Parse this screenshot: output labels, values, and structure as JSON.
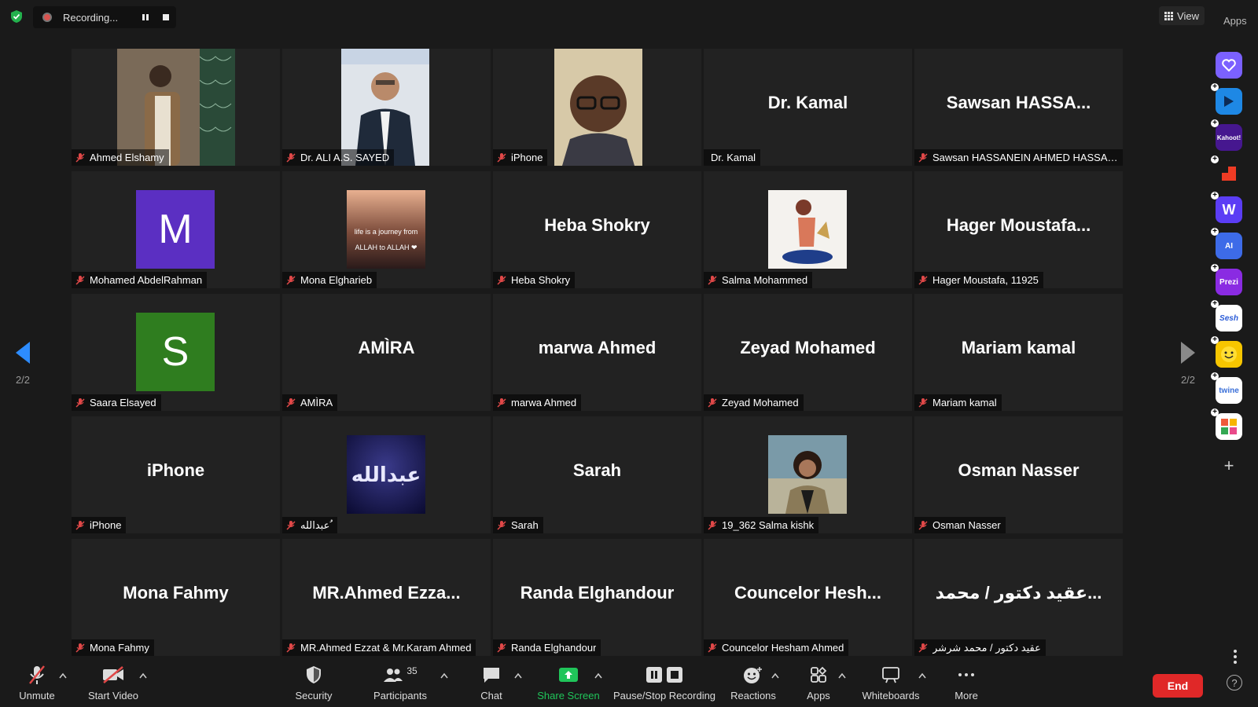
{
  "recording": {
    "label": "Recording..."
  },
  "view": {
    "label": "View"
  },
  "apps_label": "Apps",
  "pagination": {
    "left": "2/2",
    "right": "2/2"
  },
  "participants": [
    {
      "name": "Ahmed Elshamy",
      "display": "",
      "kind": "photo"
    },
    {
      "name": "Dr. ALI A.S. SAYED",
      "display": "",
      "kind": "photo"
    },
    {
      "name": "iPhone",
      "display": "",
      "kind": "photo"
    },
    {
      "name": "Dr. Kamal",
      "display": "Dr. Kamal",
      "kind": "text"
    },
    {
      "name": "Sawsan HASSANEIN AHMED HASSANEI...",
      "display": "Sawsan  HASSA...",
      "kind": "text"
    },
    {
      "name": "Mohamed AbdelRahman",
      "display": "",
      "kind": "avatar",
      "letter": "M",
      "color": "#5b2fc2"
    },
    {
      "name": "Mona Elgharieb",
      "display": "",
      "kind": "image",
      "image_text": [
        "life is a journey from",
        "ALLAH to ALLAH ❤"
      ]
    },
    {
      "name": "Heba Shokry",
      "display": "Heba Shokry",
      "kind": "text"
    },
    {
      "name": "Salma Mohammed",
      "display": "",
      "kind": "image"
    },
    {
      "name": "Hager Moustafa, 11925",
      "display": "Hager  Moustafa...",
      "kind": "text"
    },
    {
      "name": "Saara Elsayed",
      "display": "",
      "kind": "avatar",
      "letter": "S",
      "color": "#2f7d1f"
    },
    {
      "name": "AMÌRA",
      "display": "AMÌRA",
      "kind": "text"
    },
    {
      "name": "marwa Ahmed",
      "display": "marwa Ahmed",
      "kind": "text"
    },
    {
      "name": "Zeyad Mohamed",
      "display": "Zeyad Mohamed",
      "kind": "text"
    },
    {
      "name": "Mariam kamal",
      "display": "Mariam kamal",
      "kind": "text"
    },
    {
      "name": "iPhone",
      "display": "iPhone",
      "kind": "text"
    },
    {
      "name": "عبدالله ُ",
      "display": "",
      "kind": "image",
      "image_text": [
        "عبدالله"
      ]
    },
    {
      "name": "Sarah",
      "display": "Sarah",
      "kind": "text"
    },
    {
      "name": "19_362 Salma kishk",
      "display": "",
      "kind": "photo"
    },
    {
      "name": "Osman Nasser",
      "display": "Osman Nasser",
      "kind": "text"
    },
    {
      "name": "Mona Fahmy",
      "display": "Mona Fahmy",
      "kind": "text"
    },
    {
      "name": "MR.Ahmed Ezzat & Mr.Karam Ahmed",
      "display": "MR.Ahmed  Ezza...",
      "kind": "text"
    },
    {
      "name": "Randa Elghandour",
      "display": "Randa Elghandour",
      "kind": "text"
    },
    {
      "name": "Councelor Hesham Ahmed",
      "display": "Councelor  Hesh...",
      "kind": "text"
    },
    {
      "name": "عقيد دكتور / محمد شرشر",
      "display": "عقيد دكتور / محمد...",
      "kind": "text"
    }
  ],
  "sidebar_apps": [
    {
      "name": "heart-app",
      "label": "",
      "color": "#7b61ff"
    },
    {
      "name": "flow-app",
      "label": "",
      "color": "#1e88e5"
    },
    {
      "name": "kahoot-app",
      "label": "Kahoot!",
      "color": "#46178f"
    },
    {
      "name": "red-app",
      "label": "",
      "color": "#ef3b24"
    },
    {
      "name": "w-app",
      "label": "W",
      "color": "#5b3df5"
    },
    {
      "name": "ai-app",
      "label": "AI",
      "color": "#3d6be8"
    },
    {
      "name": "prezi-app",
      "label": "Prezi",
      "color": "#8a2be2"
    },
    {
      "name": "sesh-app",
      "label": "Sesh",
      "color": "#ffffff"
    },
    {
      "name": "emoji-app",
      "label": "",
      "color": "#f7c600"
    },
    {
      "name": "twine-app",
      "label": "twine",
      "color": "#ffffff"
    },
    {
      "name": "grid-app",
      "label": "",
      "color": "#ffffff"
    }
  ],
  "toolbar": {
    "unmute": "Unmute",
    "start_video": "Start Video",
    "security": "Security",
    "participants": "Participants",
    "participants_count": "35",
    "chat": "Chat",
    "share_screen": "Share Screen",
    "pause_stop": "Pause/Stop Recording",
    "reactions": "Reactions",
    "apps": "Apps",
    "whiteboards": "Whiteboards",
    "more": "More",
    "end": "End"
  },
  "colors": {
    "share_green": "#20c55a",
    "end_red": "#e02828",
    "nav_blue": "#2d8cff"
  }
}
